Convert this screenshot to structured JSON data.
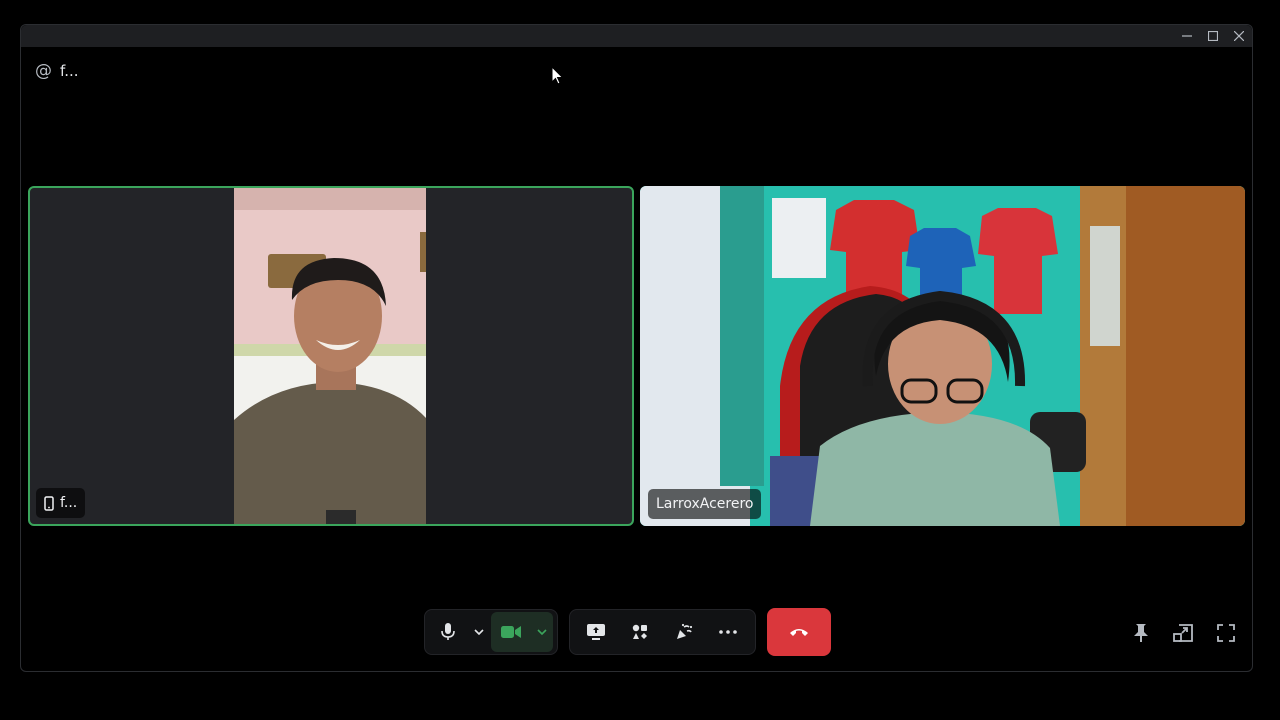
{
  "header": {
    "channel_icon": "at-icon",
    "channel_name": "f..."
  },
  "window_controls": {
    "minimize": "minimize-icon",
    "maximize": "maximize-icon",
    "close": "close-icon"
  },
  "participants": [
    {
      "name": "f...",
      "device_icon": "mobile-phone-icon",
      "speaking": true,
      "speaking_color": "#3ba55c"
    },
    {
      "name": "LarroxAcerero",
      "speaking": false
    }
  ],
  "controls": {
    "mic_icon": "microphone-icon",
    "mic_options_icon": "chevron-down-icon",
    "camera_icon": "camera-icon",
    "camera_active_color": "#3ba55c",
    "camera_options_icon": "chevron-down-icon",
    "screen_share_icon": "screen-share-icon",
    "activities_icon": "activities-icon",
    "soundboard_icon": "soundboard-icon",
    "more_icon": "more-icon",
    "disconnect_icon": "hang-up-icon",
    "disconnect_color": "#da373c"
  },
  "right_controls": {
    "pin_icon": "pin-icon",
    "popout_icon": "pop-out-icon",
    "fullscreen_icon": "fullscreen-icon"
  }
}
